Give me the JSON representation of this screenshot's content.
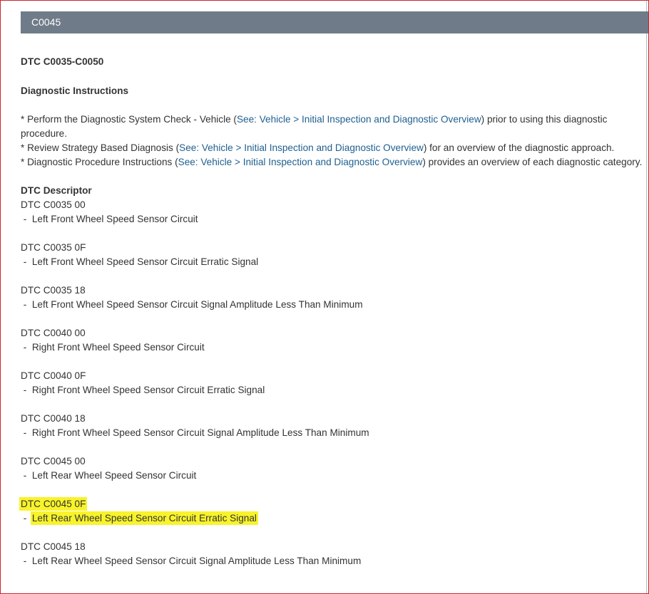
{
  "section_title": "C0045",
  "dtc_range": "DTC C0035-C0050",
  "instructions_heading": "Diagnostic Instructions",
  "instructions": [
    {
      "before": " *  Perform the Diagnostic System Check - Vehicle (",
      "link": "See: Vehicle > Initial Inspection and Diagnostic Overview",
      "after": ") prior to using this diagnostic procedure."
    },
    {
      "before": " *  Review Strategy Based Diagnosis (",
      "link": "See: Vehicle > Initial Inspection and Diagnostic Overview",
      "after": ") for an overview of the diagnostic approach."
    },
    {
      "before": " *  Diagnostic Procedure Instructions (",
      "link": "See: Vehicle > Initial Inspection and Diagnostic Overview",
      "after": ") provides an overview of each diagnostic category."
    }
  ],
  "descriptor_heading": "DTC Descriptor",
  "descriptors": [
    {
      "code": "DTC C0035 00",
      "desc": "Left Front Wheel Speed Sensor Circuit"
    },
    {
      "code": "DTC C0035 0F",
      "desc": "Left Front Wheel Speed Sensor Circuit Erratic Signal"
    },
    {
      "code": "DTC C0035 18",
      "desc": "Left Front Wheel Speed Sensor Circuit Signal Amplitude Less Than Minimum"
    },
    {
      "code": "DTC C0040 00",
      "desc": "Right Front Wheel Speed Sensor Circuit"
    },
    {
      "code": "DTC C0040 0F",
      "desc": "Right Front Wheel Speed Sensor Circuit Erratic Signal"
    },
    {
      "code": "DTC C0040 18",
      "desc": "Right Front Wheel Speed Sensor Circuit Signal Amplitude Less Than Minimum"
    },
    {
      "code": "DTC C0045 00",
      "desc": "Left Rear Wheel Speed Sensor Circuit"
    },
    {
      "code": "DTC C0045 0F",
      "desc": "Left Rear Wheel Speed Sensor Circuit Erratic Signal",
      "highlighted": true
    },
    {
      "code": "DTC C0045 18",
      "desc": "Left Rear Wheel Speed Sensor Circuit Signal Amplitude Less Than Minimum"
    }
  ],
  "dash": " -  ",
  "colors": {
    "header_bar": "#6f7b88",
    "link": "#1f5f8f",
    "highlight": "#f8f32b"
  }
}
